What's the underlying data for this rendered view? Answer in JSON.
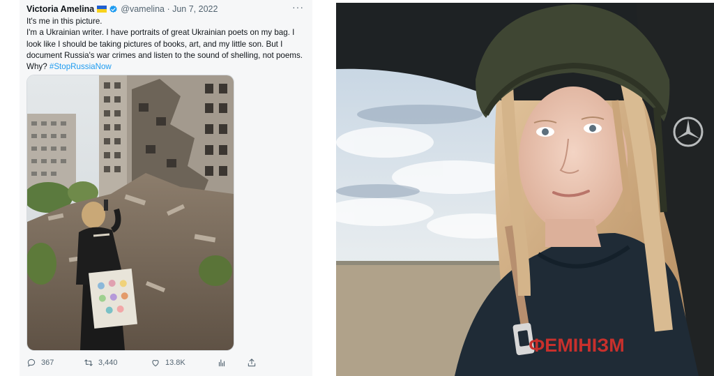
{
  "tweet": {
    "author": "Victoria Amelina",
    "handle_date": "@vamelina · Jun 7, 2022",
    "more_label": "···",
    "line1": "It's me in this picture.",
    "line2": "I'm a Ukrainian writer. I have portraits of great Ukrainian poets on my bag. I look like I should be taking pictures of books, art, and my little son. But I document Russia's war crimes and listen to the sound of shelling, not poems. Why?",
    "hashtag": "#StopRussiaNow",
    "photo_icon": "tweet-photo-ruined-building",
    "stats": {
      "replies": "367",
      "retweets": "3,440",
      "likes": "13.8K"
    },
    "icons": [
      "reply-icon",
      "retweet-icon",
      "like-icon",
      "views-icon",
      "share-icon"
    ],
    "colors": {
      "link": "#1d9bf0",
      "muted": "#536471",
      "verified": "#1d9bf0"
    }
  },
  "selfie": {
    "sweatshirt_text": "ФЕМІНІЗМ"
  }
}
